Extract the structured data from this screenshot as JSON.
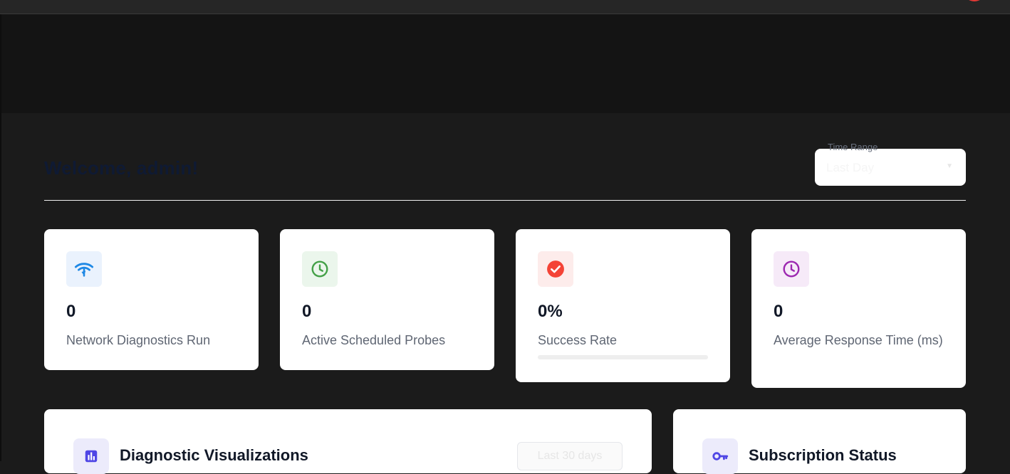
{
  "header": {
    "welcome": "Welcome, admin!"
  },
  "time_range": {
    "label": "Time Range",
    "value": "Last Day",
    "chevron_icon": "chevron-down-icon"
  },
  "stats": [
    {
      "icon": "network-icon",
      "icon_color": "#1e88e5",
      "icon_bg": "#eaf2fd",
      "value": "0",
      "label": "Network Diagnostics Run"
    },
    {
      "icon": "clock-icon",
      "icon_color": "#43a047",
      "icon_bg": "#ebf6ec",
      "value": "0",
      "label": "Active Scheduled Probes"
    },
    {
      "icon": "check-circle-icon",
      "icon_color": "#f44336",
      "icon_bg": "#fdeceb",
      "value": "0%",
      "label": "Success Rate",
      "progress": 0
    },
    {
      "icon": "clock-icon",
      "icon_color": "#9c27b0",
      "icon_bg": "#f6eaf8",
      "value": "0",
      "label": "Average Response Time (ms)"
    }
  ],
  "panels": {
    "diagnostics": {
      "title": "Diagnostic Visualizations",
      "icon": "bar-chart-icon",
      "range_button": "Last 30 days"
    },
    "subscription": {
      "title": "Subscription Status",
      "icon": "key-icon"
    }
  }
}
